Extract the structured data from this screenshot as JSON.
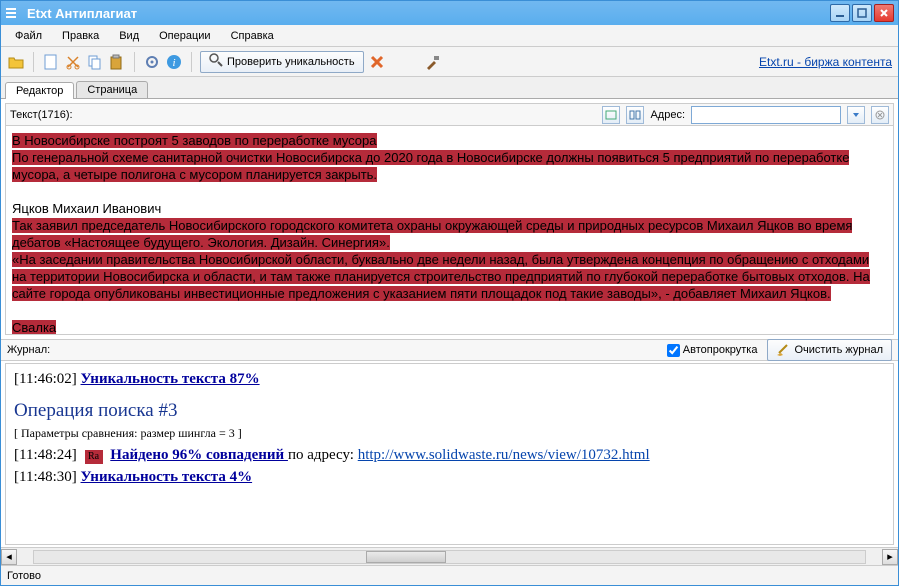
{
  "window": {
    "title": "Etxt Антиплагиат"
  },
  "menu": {
    "file": "Файл",
    "edit": "Правка",
    "view": "Вид",
    "operations": "Операции",
    "help": "Справка"
  },
  "toolbar": {
    "check_label": "Проверить уникальность",
    "right_link": "Etxt.ru - биржа контента"
  },
  "tabs": {
    "editor": "Редактор",
    "page": "Страница"
  },
  "editor": {
    "text_label": "Текст(1716):",
    "addr_label": "Адрес:",
    "addr_value": "",
    "content": {
      "p1": "В Новосибирске построят 5 заводов по переработке мусора",
      "p2": "По генеральной схеме санитарной очистки Новосибирска до 2020 года в Новосибирске должны появиться 5 предприятий по переработке мусора, а четыре полигона с мусором планируется закрыть.",
      "p3": "Яцков Михаил Иванович",
      "p4": "Так заявил председатель Новосибирского городского комитета охраны окружающей среды и природных ресурсов Михаил Яцков во время дебатов «Настоящее будущего. Экология. Дизайн. Синергия».",
      "p5": "«На заседании правительства Новосибирской области, буквально две недели назад, была утверждена концепция по обращению с отходами на территории Новосибирска и области, и там также планируется строительство предприятий по глубокой переработке бытовых отходов. На сайте города опубликованы инвестиционные предложения с указанием пяти площадок под такие заводы», - добавляет Михаил Яцков.",
      "p6": "Свалка"
    }
  },
  "journal": {
    "label": "Журнал:",
    "autoscroll": "Автопрокрутка",
    "clear": "Очистить журнал",
    "lines": {
      "l1_ts": "[11:46:02]",
      "l1_link": "Уникальность текста 87%",
      "op_title": "Операция поиска #3",
      "params": "[ Параметры сравнения: размер шингла = 3 ]",
      "l2_ts": "[11:48:24]",
      "l2_fav": "Ra",
      "l2_link": "Найдено 96% совпадений ",
      "l2_mid": "по адресу: ",
      "l2_url": "http://www.solidwaste.ru/news/view/10732.html",
      "l3_ts": "[11:48:30]",
      "l3_link": "Уникальность текста 4%"
    }
  },
  "status": {
    "text": "Готово"
  }
}
